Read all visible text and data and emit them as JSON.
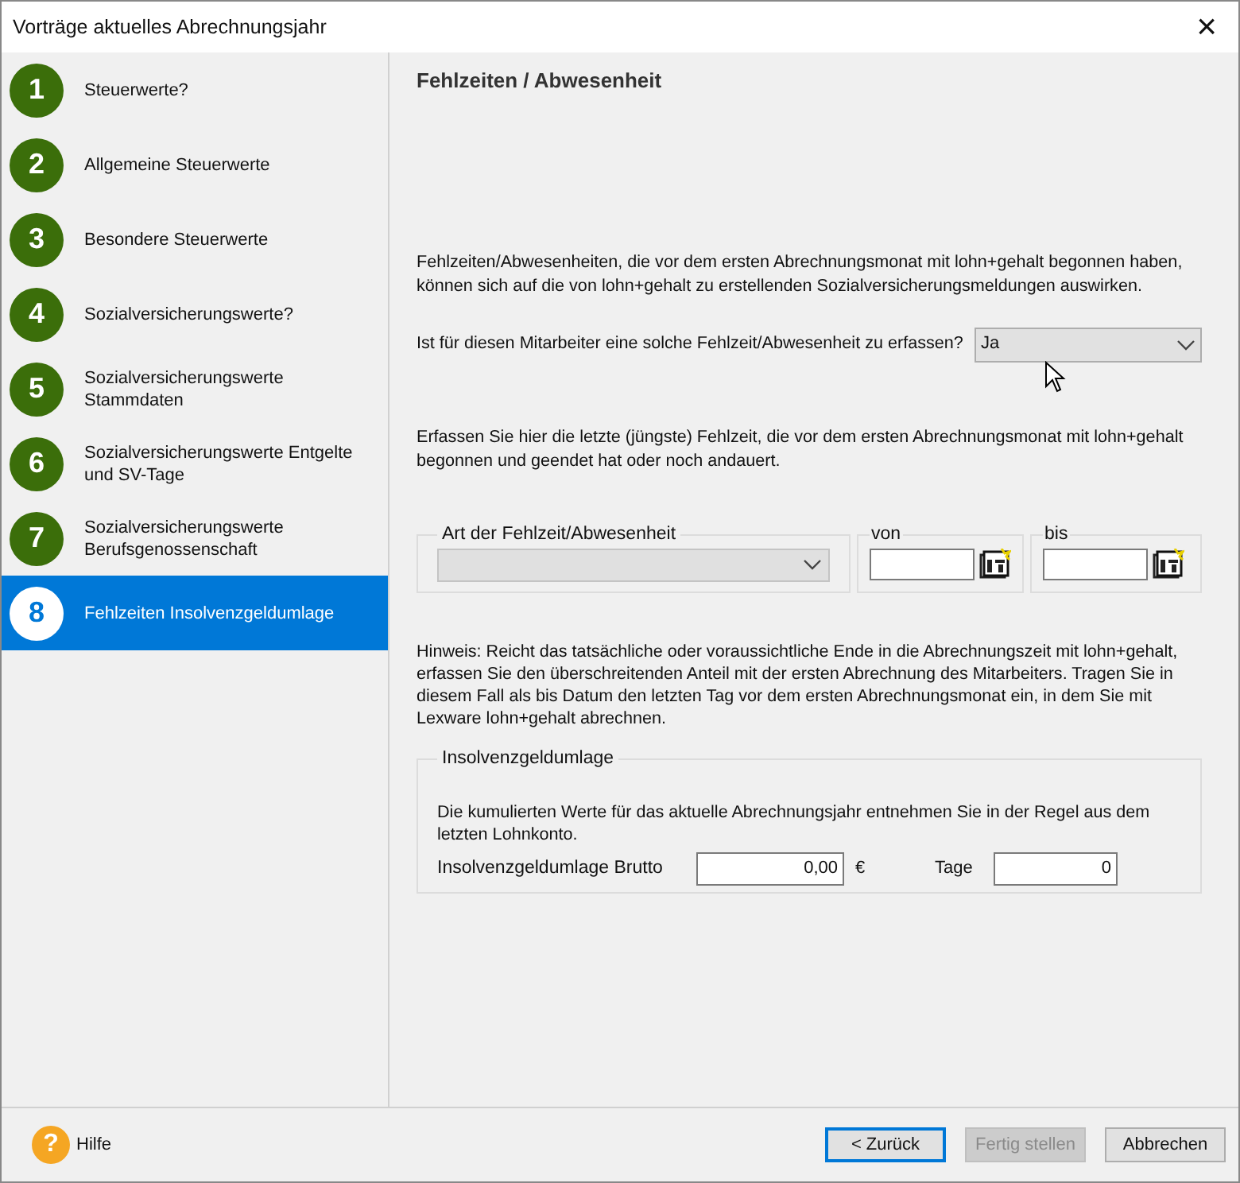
{
  "window": {
    "title": "Vorträge aktuelles Abrechnungsjahr",
    "close": "×"
  },
  "steps": [
    {
      "number": "1",
      "label": "Steuerwerte?",
      "selected": false
    },
    {
      "number": "2",
      "label": "Allgemeine Steuerwerte",
      "selected": false
    },
    {
      "number": "3",
      "label": "Besondere Steuerwerte",
      "selected": false
    },
    {
      "number": "4",
      "label": "Sozialversicherungswerte?",
      "selected": false
    },
    {
      "number": "5",
      "label": "Sozialversicherungswerte Stammdaten",
      "selected": false
    },
    {
      "number": "6",
      "label": "Sozialversicherungswerte Entgelte und SV-Tage",
      "selected": false
    },
    {
      "number": "7",
      "label": "Sozialversicherungswerte Berufsgenossenschaft",
      "selected": false
    },
    {
      "number": "8",
      "label": "Fehlzeiten Insolvenzgeldumlage",
      "selected": true
    }
  ],
  "page": {
    "heading": "Fehlzeiten / Abwesenheit",
    "intro": "Fehlzeiten/Abwesenheiten, die vor dem ersten Abrechnungsmonat mit lohn+gehalt begonnen haben, können sich auf die von lohn+gehalt zu erstellenden Sozialversicherungsmeldungen auswirken.",
    "question": {
      "label": "Ist für diesen Mitarbeiter eine solche Fehlzeit/Abwesenheit zu erfassen?",
      "value": "Ja"
    },
    "instruction": "Erfassen Sie hier die letzte (jüngste) Fehlzeit, die vor dem ersten Abrechnungsmonat mit lohn+gehalt begonnen und geendet hat oder noch andauert.",
    "absence": {
      "type_label": "Art der Fehlzeit/Abwesenheit",
      "type_disabled": true,
      "from_label": "von",
      "to_label": "bis"
    },
    "note": "Hinweis: Reicht das tatsächliche oder voraussichtliche Ende in die Abrechnungszeit mit lohn+gehalt, erfassen Sie den überschreitenden Anteil mit der ersten Abrechnung des Mitarbeiters. Tragen Sie in diesem Fall als bis Datum den letzten Tag vor dem ersten Abrechnungsmonat ein, in dem Sie mit Lexware lohn+gehalt abrechnen.",
    "insolvency": {
      "title": "Insolvenzgeldumlage",
      "text": "Die kumulierten Werte für das aktuelle Abrechnungsjahr entnehmen Sie in der Regel aus dem letzten Lohnkonto.",
      "gross_label": "Insolvenzgeldumlage Brutto",
      "gross_value": "0,00",
      "currency": "€",
      "days_label": "Tage",
      "days_value": "0"
    }
  },
  "footer": {
    "help": "Hilfe",
    "help_icon": "?",
    "buttons": [
      {
        "label": "< Zurück",
        "default": true,
        "disabled": false
      },
      {
        "label": "Fertig stellen",
        "default": false,
        "disabled": true
      },
      {
        "label": "Abbrechen",
        "default": false,
        "disabled": false
      }
    ]
  }
}
